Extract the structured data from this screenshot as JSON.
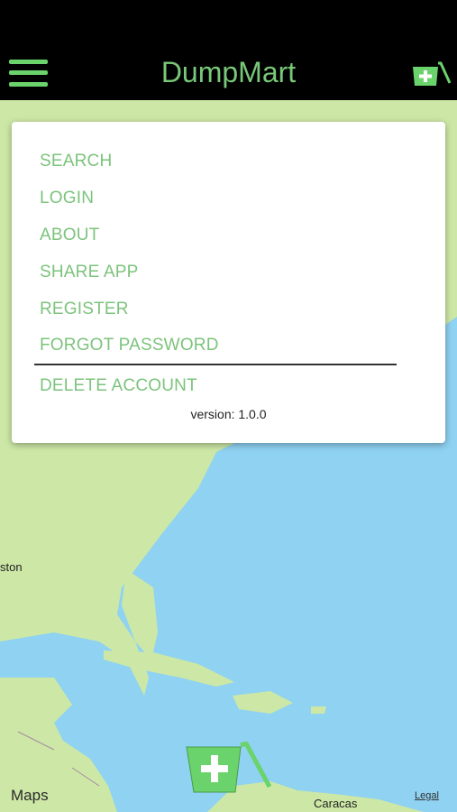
{
  "header": {
    "title": "DumpMart",
    "menu_icon": "hamburger-menu-icon",
    "cart_icon": "add-dumpster-icon"
  },
  "menu": {
    "items": [
      {
        "label": "SEARCH"
      },
      {
        "label": "LOGIN"
      },
      {
        "label": "ABOUT"
      },
      {
        "label": "SHARE APP"
      },
      {
        "label": "REGISTER"
      },
      {
        "label": "FORGOT PASSWORD"
      },
      {
        "label": "DELETE ACCOUNT"
      }
    ],
    "version": "version: 1.0.0"
  },
  "map": {
    "labels": {
      "left_city": "ston",
      "bottom_city": "Caracas"
    },
    "attribution": "Maps",
    "legal": "Legal"
  },
  "colors": {
    "accent": "#79c879",
    "water": "#8fd2f1",
    "land": "#cde8a6"
  }
}
